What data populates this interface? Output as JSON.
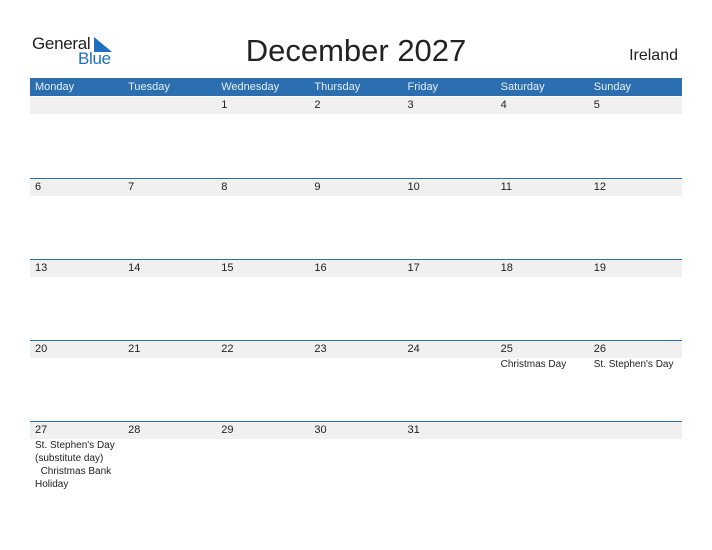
{
  "logo": {
    "word1": "General",
    "word2": "Blue",
    "accent": "#1e6fc0"
  },
  "title": "December 2027",
  "country": "Ireland",
  "colors": {
    "header_bg": "#2c6fb0",
    "date_row_bg": "#f0f0f0"
  },
  "weekdays": [
    "Monday",
    "Tuesday",
    "Wednesday",
    "Thursday",
    "Friday",
    "Saturday",
    "Sunday"
  ],
  "weeks": [
    {
      "days": [
        "",
        "",
        "1",
        "2",
        "3",
        "4",
        "5"
      ],
      "holidays": [
        "",
        "",
        "",
        "",
        "",
        "",
        ""
      ]
    },
    {
      "days": [
        "6",
        "7",
        "8",
        "9",
        "10",
        "11",
        "12"
      ],
      "holidays": [
        "",
        "",
        "",
        "",
        "",
        "",
        ""
      ]
    },
    {
      "days": [
        "13",
        "14",
        "15",
        "16",
        "17",
        "18",
        "19"
      ],
      "holidays": [
        "",
        "",
        "",
        "",
        "",
        "",
        ""
      ]
    },
    {
      "days": [
        "20",
        "21",
        "22",
        "23",
        "24",
        "25",
        "26"
      ],
      "holidays": [
        "",
        "",
        "",
        "",
        "",
        "Christmas Day",
        "St. Stephen's Day"
      ]
    },
    {
      "days": [
        "27",
        "28",
        "29",
        "30",
        "31",
        "",
        ""
      ],
      "holidays": [
        "St. Stephen's Day (substitute day)\n  Christmas Bank Holiday",
        "",
        "",
        "",
        "",
        "",
        ""
      ]
    }
  ]
}
